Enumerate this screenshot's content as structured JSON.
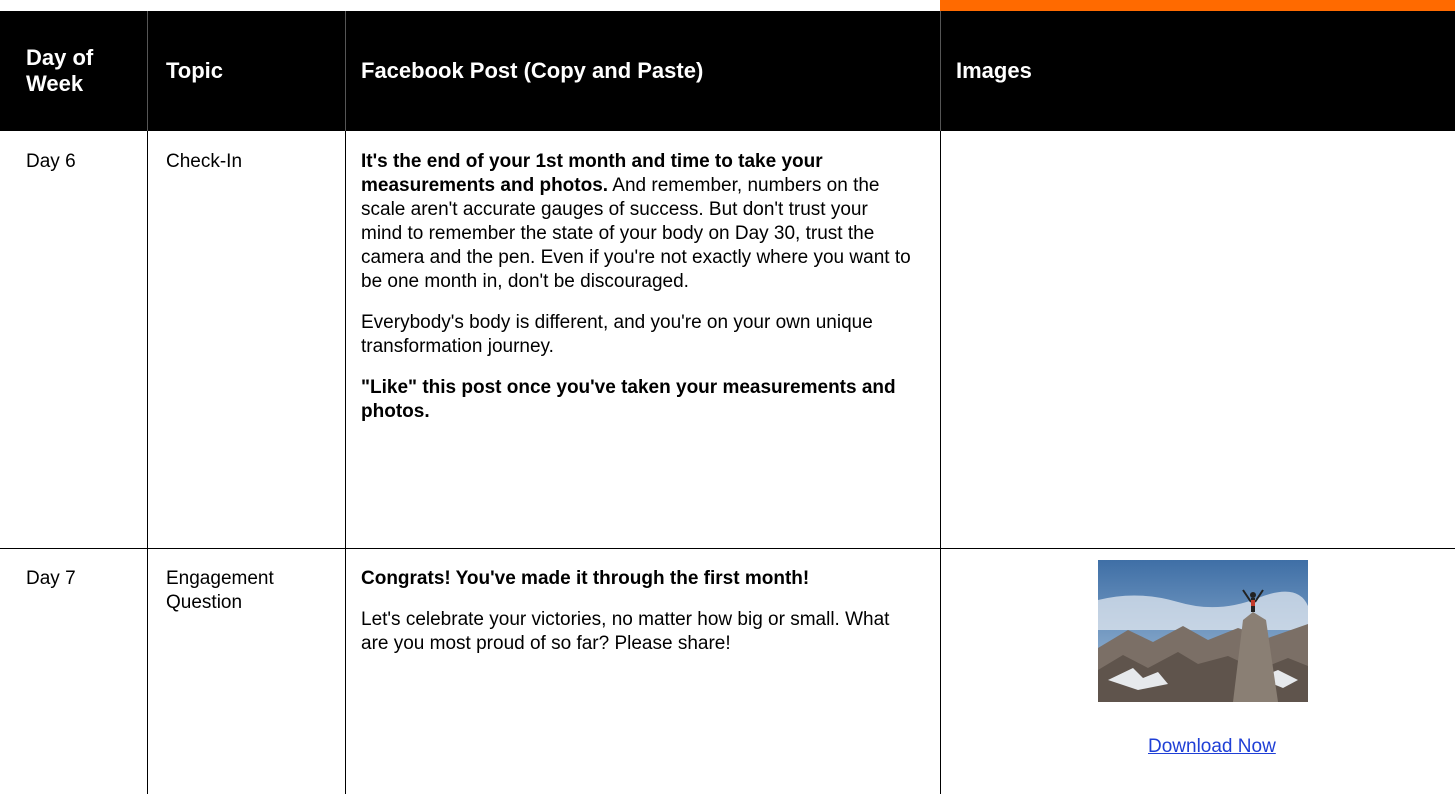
{
  "header": {
    "col1": "Day of Week",
    "col1_line1": "Day of",
    "col1_line2": "Week",
    "col2": "Topic",
    "col3": "Facebook Post (Copy and Paste)",
    "col4": "Images"
  },
  "rows": [
    {
      "day": "Day 6",
      "topic": "Check-In",
      "post": {
        "p1_bold": "It's the end of your 1st month and time to take your measurements and photos.",
        "p1_rest": " And remember, numbers on the scale aren't accurate gauges of success. But don't trust your mind to remember the state of your body on Day 30, trust the camera and the pen. Even if you're not exactly where you want to be one month in, don't be discouraged.",
        "p2": "Everybody's body is different, and you're on your own unique transformation journey.",
        "p3_bold": "\"Like\" this post once you've taken your measurements and photos."
      }
    },
    {
      "day": "Day 7",
      "topic_line1": "Engagement",
      "topic_line2": "Question",
      "post": {
        "p1_bold": "Congrats! You've made it through the first month!",
        "p2": "Let's celebrate your victories, no matter how big or small. What are you most proud of so far? Please share!"
      },
      "image_icon": "mountain-summit-photo",
      "download_label": "Download Now"
    }
  ],
  "colors": {
    "accent_bar": "#ff6a00",
    "header_bg": "#000000",
    "link": "#1f3fd6"
  }
}
